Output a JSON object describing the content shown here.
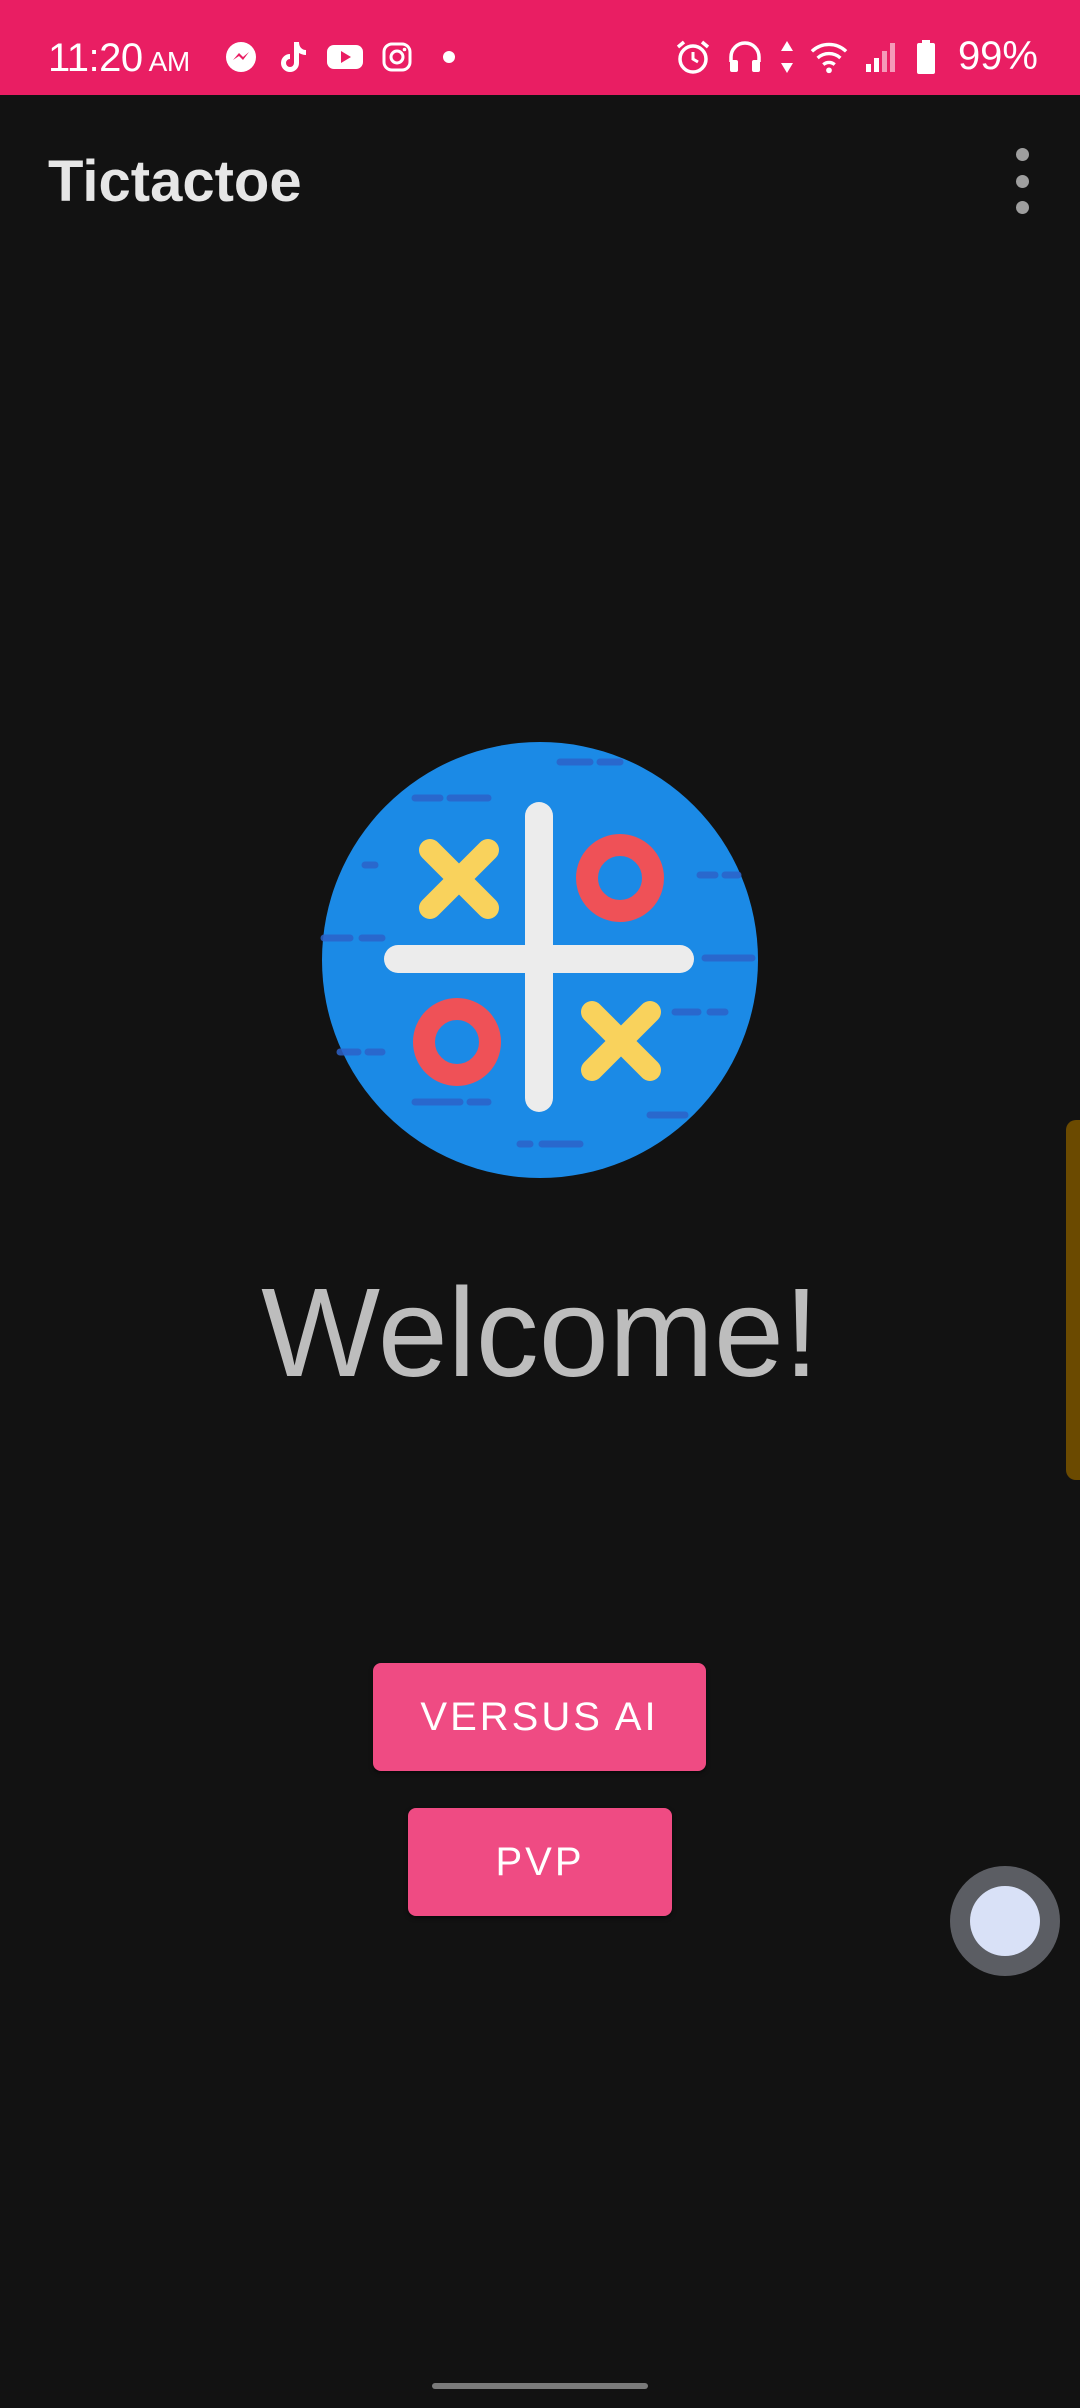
{
  "status_bar": {
    "time": "11:20",
    "ampm": "AM",
    "notification_icons": [
      "messenger-icon",
      "tiktok-icon",
      "youtube-icon",
      "instagram-icon",
      "dot-icon"
    ],
    "system_icons": [
      "alarm-icon",
      "headphones-icon",
      "data-arrows-icon",
      "wifi-icon",
      "signal-icon",
      "battery-icon"
    ],
    "battery": "99%",
    "color": "#e91e63"
  },
  "app_bar": {
    "title": "Tictactoe",
    "menu_icon": "more-vert-icon"
  },
  "logo": {
    "icon": "tic-tac-toe-logo-icon",
    "colors": {
      "circle": "#1b8ae6",
      "grid": "#ececec",
      "x": "#f9d25c",
      "o": "#ef5157"
    }
  },
  "main": {
    "welcome": "Welcome!"
  },
  "buttons": {
    "versus_ai": "VERSUS AI",
    "pvp": "PVP",
    "color": "#ef4b83"
  },
  "overlay": {
    "assistive_ball": "assistive-touch-icon"
  }
}
